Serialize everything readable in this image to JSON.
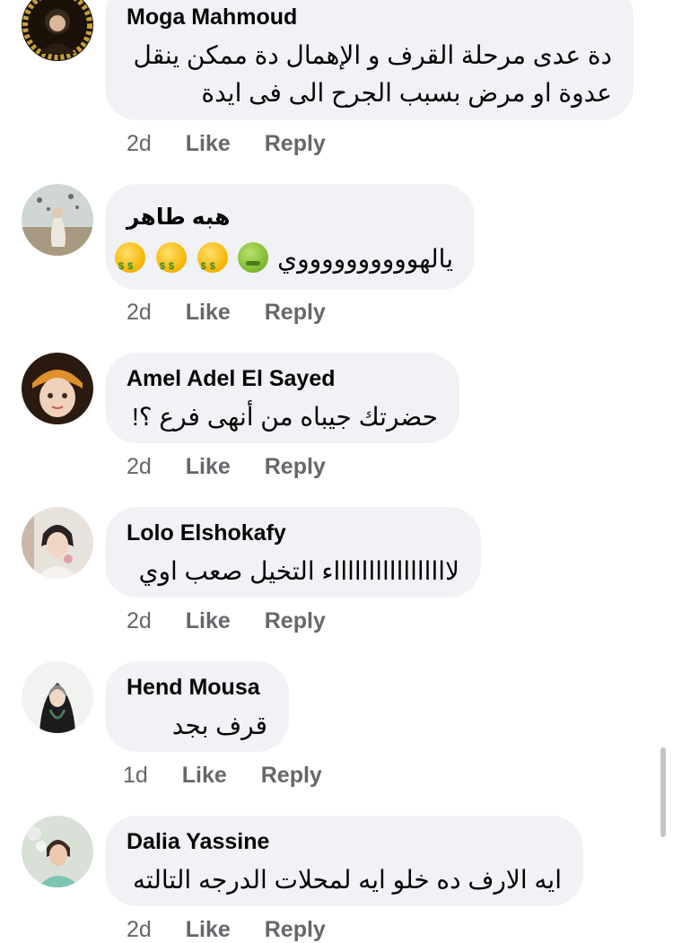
{
  "comments": [
    {
      "author": "Moga Mahmoud",
      "lines": [
        "دة عدى مرحلة القرف و الإهمال  دة ممكن ينقل",
        "عدوة او مرض بسبب الجرح الى فى ايدة"
      ],
      "time": "2d",
      "like": "Like",
      "reply": "Reply"
    },
    {
      "author": "هبه طاهر",
      "text": "يالهووووووووووي",
      "emojis": [
        "money-mouth-face",
        "money-mouth-face",
        "money-mouth-face",
        "nauseated-face"
      ],
      "time": "2d",
      "like": "Like",
      "reply": "Reply"
    },
    {
      "author": "Amel Adel El Sayed",
      "text": "حضرتك جيباه من أنهى فرع ؟!",
      "time": "2d",
      "like": "Like",
      "reply": "Reply"
    },
    {
      "author": "Lolo Elshokafy",
      "text": "لاااااااااااااااااء التخيل صعب اوي",
      "time": "2d",
      "like": "Like",
      "reply": "Reply"
    },
    {
      "author": "Hend Mousa",
      "text": "قرف بجد",
      "time": "1d",
      "like": "Like",
      "reply": "Reply"
    },
    {
      "author": "Dalia Yassine",
      "text": "ايه الارف ده خلو ايه لمحلات الدرجه التالته",
      "time": "2d",
      "like": "Like",
      "reply": "Reply"
    }
  ],
  "colors": {
    "bubble": "#f0f2f5",
    "secondary_text": "#65676b",
    "primary_text": "#050505"
  }
}
